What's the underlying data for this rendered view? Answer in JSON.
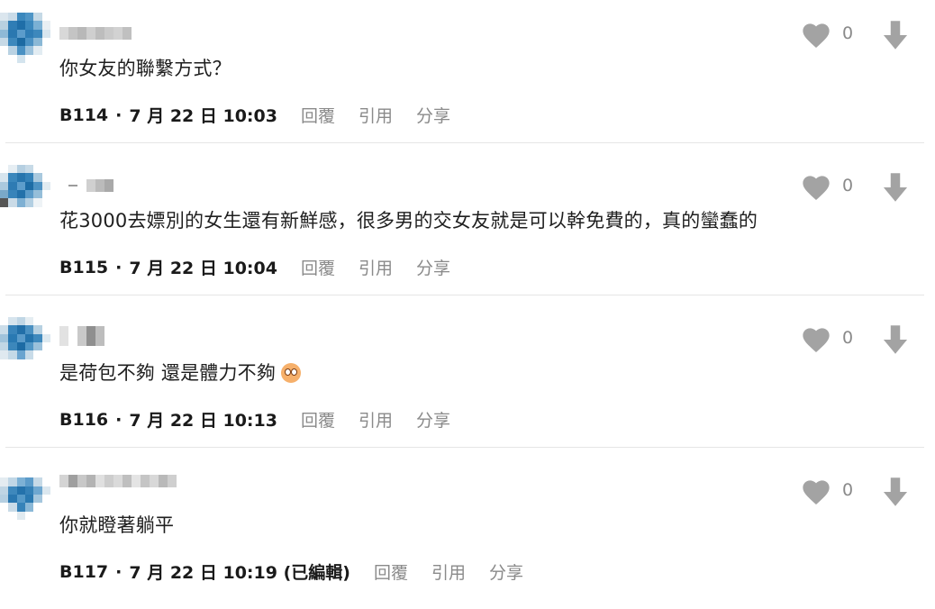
{
  "comments": [
    {
      "text": "你女友的聯繫方式？",
      "floor": "B114",
      "sep": "·",
      "time": "7 月 22 日 10:03",
      "likes": "0",
      "reply_label": "回覆",
      "quote_label": "引用",
      "share_label": "分享"
    },
    {
      "text": "花3000去嫖別的女生還有新鮮感，很多男的交女友就是可以幹免費的，真的蠻蠢的",
      "floor": "B115",
      "sep": "·",
      "time": "7 月 22 日 10:04",
      "likes": "0",
      "reply_label": "回覆",
      "quote_label": "引用",
      "share_label": "分享"
    },
    {
      "text": "是荷包不夠 還是體力不夠",
      "floor": "B116",
      "sep": "·",
      "time": "7 月 22 日 10:13",
      "likes": "0",
      "reply_label": "回覆",
      "quote_label": "引用",
      "share_label": "分享"
    },
    {
      "text": "你就瞪著躺平",
      "floor": "B117",
      "sep": "·",
      "time": "7 月 22 日 10:19 (已編輯)",
      "likes": "0",
      "reply_label": "回覆",
      "quote_label": "引用",
      "share_label": "分享"
    }
  ],
  "icons": {
    "like": "heart-icon",
    "dislike": "arrow-down-icon",
    "avatar": "pixelated-avatar",
    "emoji": "flushed-face-emoji"
  },
  "colors": {
    "icon": "#9a9a9a",
    "meta_action": "#8a8a8a",
    "text": "#1f1f1f",
    "divider": "#e5e5e5"
  }
}
